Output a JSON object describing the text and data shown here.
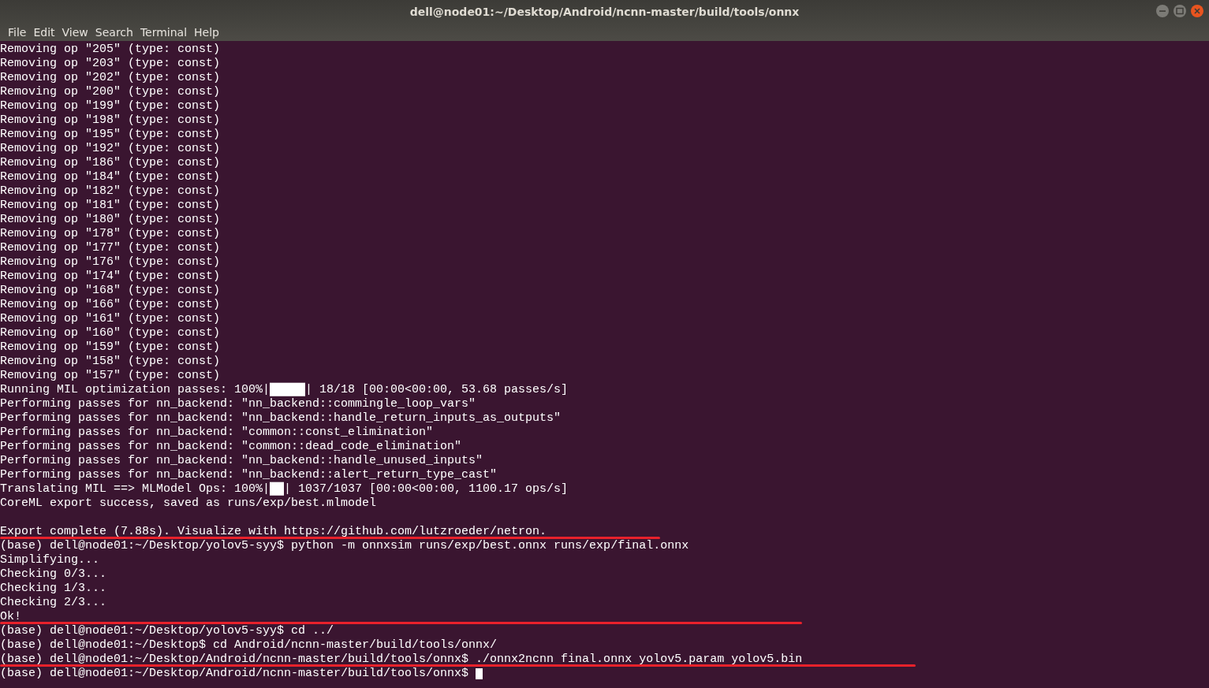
{
  "window": {
    "title": "dell@node01:~/Desktop/Android/ncnn-master/build/tools/onnx"
  },
  "menu": [
    "File",
    "Edit",
    "View",
    "Search",
    "Terminal",
    "Help"
  ],
  "lines": [
    {
      "text": "Removing op \"205\" (type: const)",
      "marked": false,
      "cursor": false
    },
    {
      "text": "Removing op \"203\" (type: const)",
      "marked": false,
      "cursor": false
    },
    {
      "text": "Removing op \"202\" (type: const)",
      "marked": false,
      "cursor": false
    },
    {
      "text": "Removing op \"200\" (type: const)",
      "marked": false,
      "cursor": false
    },
    {
      "text": "Removing op \"199\" (type: const)",
      "marked": false,
      "cursor": false
    },
    {
      "text": "Removing op \"198\" (type: const)",
      "marked": false,
      "cursor": false
    },
    {
      "text": "Removing op \"195\" (type: const)",
      "marked": false,
      "cursor": false
    },
    {
      "text": "Removing op \"192\" (type: const)",
      "marked": false,
      "cursor": false
    },
    {
      "text": "Removing op \"186\" (type: const)",
      "marked": false,
      "cursor": false
    },
    {
      "text": "Removing op \"184\" (type: const)",
      "marked": false,
      "cursor": false
    },
    {
      "text": "Removing op \"182\" (type: const)",
      "marked": false,
      "cursor": false
    },
    {
      "text": "Removing op \"181\" (type: const)",
      "marked": false,
      "cursor": false
    },
    {
      "text": "Removing op \"180\" (type: const)",
      "marked": false,
      "cursor": false
    },
    {
      "text": "Removing op \"178\" (type: const)",
      "marked": false,
      "cursor": false
    },
    {
      "text": "Removing op \"177\" (type: const)",
      "marked": false,
      "cursor": false
    },
    {
      "text": "Removing op \"176\" (type: const)",
      "marked": false,
      "cursor": false
    },
    {
      "text": "Removing op \"174\" (type: const)",
      "marked": false,
      "cursor": false
    },
    {
      "text": "Removing op \"168\" (type: const)",
      "marked": false,
      "cursor": false
    },
    {
      "text": "Removing op \"166\" (type: const)",
      "marked": false,
      "cursor": false
    },
    {
      "text": "Removing op \"161\" (type: const)",
      "marked": false,
      "cursor": false
    },
    {
      "text": "Removing op \"160\" (type: const)",
      "marked": false,
      "cursor": false
    },
    {
      "text": "Removing op \"159\" (type: const)",
      "marked": false,
      "cursor": false
    },
    {
      "text": "Removing op \"158\" (type: const)",
      "marked": false,
      "cursor": false
    },
    {
      "text": "Removing op \"157\" (type: const)",
      "marked": false,
      "cursor": false
    },
    {
      "text": "Running MIL optimization passes: 100%|█████| 18/18 [00:00<00:00, 53.68 passes/s]",
      "marked": false,
      "cursor": false
    },
    {
      "text": "Performing passes for nn_backend: \"nn_backend::commingle_loop_vars\"",
      "marked": false,
      "cursor": false
    },
    {
      "text": "Performing passes for nn_backend: \"nn_backend::handle_return_inputs_as_outputs\"",
      "marked": false,
      "cursor": false
    },
    {
      "text": "Performing passes for nn_backend: \"common::const_elimination\"",
      "marked": false,
      "cursor": false
    },
    {
      "text": "Performing passes for nn_backend: \"common::dead_code_elimination\"",
      "marked": false,
      "cursor": false
    },
    {
      "text": "Performing passes for nn_backend: \"nn_backend::handle_unused_inputs\"",
      "marked": false,
      "cursor": false
    },
    {
      "text": "Performing passes for nn_backend: \"nn_backend::alert_return_type_cast\"",
      "marked": false,
      "cursor": false
    },
    {
      "text": "Translating MIL ==> MLModel Ops: 100%|██| 1037/1037 [00:00<00:00, 1100.17 ops/s]",
      "marked": false,
      "cursor": false
    },
    {
      "text": "CoreML export success, saved as runs/exp/best.mlmodel",
      "marked": false,
      "cursor": false
    },
    {
      "marked": false,
      "cursor": false
    },
    {
      "text": "Export complete (7.88s). Visualize with https://github.com/lutzroeder/netron.",
      "marked": true,
      "cursor": false
    },
    {
      "text": "(base) dell@node01:~/Desktop/yolov5-syy$ python -m onnxsim runs/exp/best.onnx runs/exp/final.onnx",
      "marked": false,
      "cursor": false
    },
    {
      "text": "Simplifying...",
      "marked": false,
      "cursor": false
    },
    {
      "text": "Checking 0/3...",
      "marked": false,
      "cursor": false
    },
    {
      "text": "Checking 1/3...",
      "marked": false,
      "cursor": false
    },
    {
      "text": "Checking 2/3...",
      "marked": false,
      "cursor": false
    },
    {
      "text": "Ok!",
      "marked": true,
      "cursor": false
    },
    {
      "text": "(base) dell@node01:~/Desktop/yolov5-syy$ cd ../",
      "marked": false,
      "cursor": false
    },
    {
      "text": "(base) dell@node01:~/Desktop$ cd Android/ncnn-master/build/tools/onnx/",
      "marked": false,
      "cursor": false
    },
    {
      "text": "(base) dell@node01:~/Desktop/Android/ncnn-master/build/tools/onnx$ ./onnx2ncnn final.onnx yolov5.param yolov5.bin",
      "marked": true,
      "cursor": false
    },
    {
      "text": "(base) dell@node01:~/Desktop/Android/ncnn-master/build/tools/onnx$",
      "marked": false,
      "cursor": true
    }
  ]
}
